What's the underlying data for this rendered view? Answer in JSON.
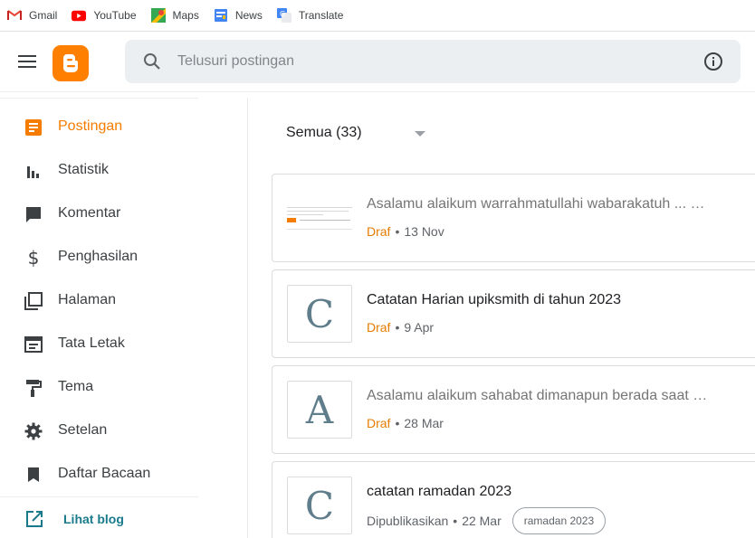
{
  "bookmarks": [
    {
      "label": "Gmail",
      "icon": "gmail-icon"
    },
    {
      "label": "YouTube",
      "icon": "youtube-icon"
    },
    {
      "label": "Maps",
      "icon": "maps-icon"
    },
    {
      "label": "News",
      "icon": "news-icon"
    },
    {
      "label": "Translate",
      "icon": "translate-icon"
    }
  ],
  "search": {
    "placeholder": "Telusuri postingan"
  },
  "sidebar": {
    "items": [
      {
        "label": "Postingan",
        "icon": "posts-icon"
      },
      {
        "label": "Statistik",
        "icon": "stats-icon"
      },
      {
        "label": "Komentar",
        "icon": "comment-icon"
      },
      {
        "label": "Penghasilan",
        "icon": "dollar-icon"
      },
      {
        "label": "Halaman",
        "icon": "pages-icon"
      },
      {
        "label": "Tata Letak",
        "icon": "layout-icon"
      },
      {
        "label": "Tema",
        "icon": "paint-roller-icon"
      },
      {
        "label": "Setelan",
        "icon": "gear-icon"
      },
      {
        "label": "Daftar Bacaan",
        "icon": "bookmark-icon"
      }
    ],
    "view_blog": "Lihat blog"
  },
  "filter": {
    "label": "Semua (33)"
  },
  "posts": [
    {
      "title": "Asalamu alaikum warrahmatullahi wabarakatuh ... …",
      "status": "Draf",
      "date": "13 Nov",
      "thumb": ""
    },
    {
      "title": "Catatan Harian upiksmith di tahun 2023",
      "status": "Draf",
      "date": "9 Apr",
      "thumb": "C"
    },
    {
      "title": "Asalamu alaikum sahabat dimanapun berada saat …",
      "status": "Draf",
      "date": "28 Mar",
      "thumb": "A"
    },
    {
      "title": "catatan ramadan 2023",
      "status": "Dipublikasikan",
      "date": "22 Mar",
      "thumb": "C",
      "label": "ramadan 2023"
    }
  ],
  "colors": {
    "accent": "#f57c00",
    "logo": "#ff8000",
    "link": "#1a7a8c"
  }
}
